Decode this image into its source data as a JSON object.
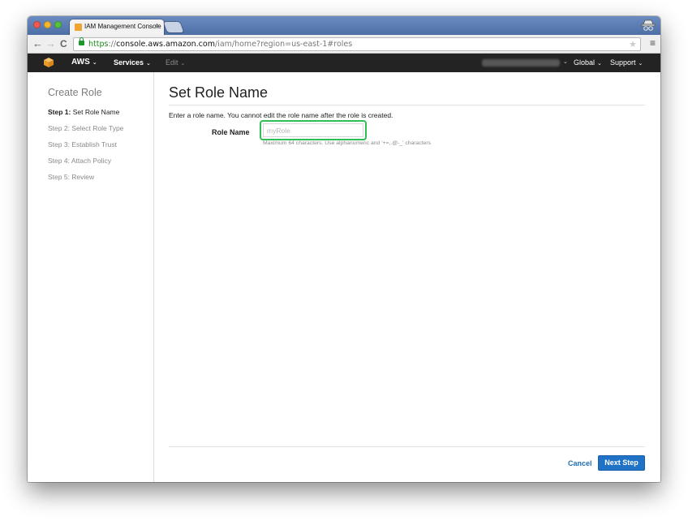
{
  "browser": {
    "tab_title": "IAM Management Console",
    "tab_close": "×",
    "url_scheme": "https",
    "url_sep": "://",
    "url_host": "console.aws.amazon.com",
    "url_path": "/iam/home?region=us-east-1#roles",
    "back_glyph": "←",
    "forward_glyph": "→",
    "reload_glyph": "C",
    "star_glyph": "★",
    "menu_glyph": "≡"
  },
  "aws_nav": {
    "brand": "AWS",
    "services": "Services",
    "edit": "Edit",
    "region": "Global",
    "support": "Support",
    "caret": "⌄"
  },
  "sidebar": {
    "title": "Create Role",
    "steps": [
      {
        "prefix": "Step 1:",
        "label": "Set Role Name"
      },
      {
        "label": "Step 2: Select Role Type"
      },
      {
        "label": "Step 3: Establish Trust"
      },
      {
        "label": "Step 4: Attach Policy"
      },
      {
        "label": "Step 5: Review"
      }
    ]
  },
  "main": {
    "title": "Set Role Name",
    "intro": "Enter a role name. You cannot edit the role name after the role is created.",
    "field_label": "Role Name",
    "input_value": "",
    "input_placeholder": "myRole",
    "hint": "Maximum 64 characters. Use alphanumeric and '+=,.@-_' characters",
    "cancel_label": "Cancel",
    "next_label": "Next Step"
  },
  "colors": {
    "highlight": "#2fbf55",
    "primary_button": "#1f72c6",
    "link": "#1e6fb8",
    "aws_orange": "#f0a531",
    "nav_bg": "#232323"
  },
  "icons": [
    "close-window-icon",
    "minimize-window-icon",
    "maximize-window-icon",
    "favicon-icon",
    "lock-icon",
    "star-icon",
    "menu-icon",
    "aws-cube-icon",
    "incognito-icon"
  ]
}
